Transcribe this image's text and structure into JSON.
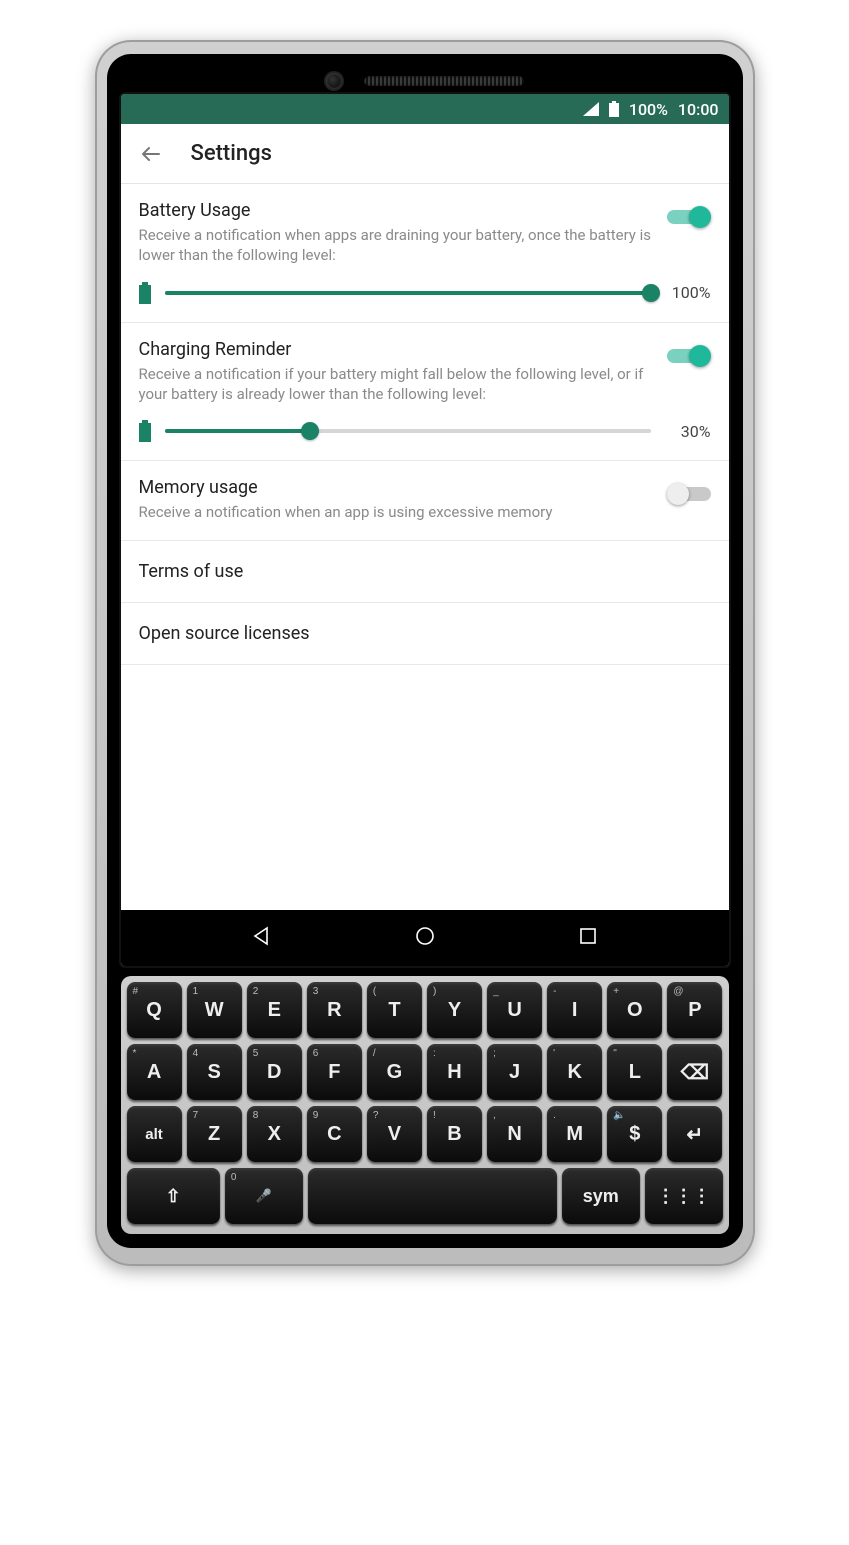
{
  "statusbar": {
    "battery_pct": "100%",
    "time": "10:00"
  },
  "appbar": {
    "title": "Settings"
  },
  "items": {
    "battery_usage": {
      "title": "Battery Usage",
      "desc": "Receive a notification when apps are draining your battery, once the battery is lower than the following level:",
      "toggle_on": true,
      "slider_pct": 100,
      "slider_label": "100%"
    },
    "charging_reminder": {
      "title": "Charging Reminder",
      "desc": "Receive a notification if your battery might fall below the following level, or if your battery is already lower than the following level:",
      "toggle_on": true,
      "slider_pct": 30,
      "slider_label": "30%"
    },
    "memory_usage": {
      "title": "Memory usage",
      "desc": "Receive a notification when an app is using excessive memory",
      "toggle_on": false
    },
    "terms": {
      "title": "Terms of use"
    },
    "licenses": {
      "title": "Open source licenses"
    }
  },
  "keyboard": {
    "rows": [
      [
        {
          "main": "Q",
          "sup": "#"
        },
        {
          "main": "W",
          "sup": "1"
        },
        {
          "main": "E",
          "sup": "2"
        },
        {
          "main": "R",
          "sup": "3"
        },
        {
          "main": "T",
          "sup": "("
        },
        {
          "main": "Y",
          "sup": ")"
        },
        {
          "main": "U",
          "sup": "_"
        },
        {
          "main": "I",
          "sup": "-"
        },
        {
          "main": "O",
          "sup": "+"
        },
        {
          "main": "P",
          "sup": "@"
        }
      ],
      [
        {
          "main": "A",
          "sup": "*"
        },
        {
          "main": "S",
          "sup": "4"
        },
        {
          "main": "D",
          "sup": "5"
        },
        {
          "main": "F",
          "sup": "6"
        },
        {
          "main": "G",
          "sup": "/"
        },
        {
          "main": "H",
          "sup": ":"
        },
        {
          "main": "J",
          "sup": ";"
        },
        {
          "main": "K",
          "sup": "'"
        },
        {
          "main": "L",
          "sup": "\""
        },
        {
          "main": "⌫",
          "sup": ""
        }
      ],
      [
        {
          "main": "alt",
          "sup": ""
        },
        {
          "main": "Z",
          "sup": "7"
        },
        {
          "main": "X",
          "sup": "8"
        },
        {
          "main": "C",
          "sup": "9"
        },
        {
          "main": "V",
          "sup": "?"
        },
        {
          "main": "B",
          "sup": "!"
        },
        {
          "main": "N",
          "sup": ","
        },
        {
          "main": "M",
          "sup": "."
        },
        {
          "main": "$",
          "sup": "🔈"
        },
        {
          "main": "↵",
          "sup": ""
        }
      ]
    ],
    "bottom": {
      "shift": "⇧",
      "zero": "0",
      "mic": "🎤",
      "sym": "sym",
      "grid": "⋮⋮⋮"
    }
  }
}
